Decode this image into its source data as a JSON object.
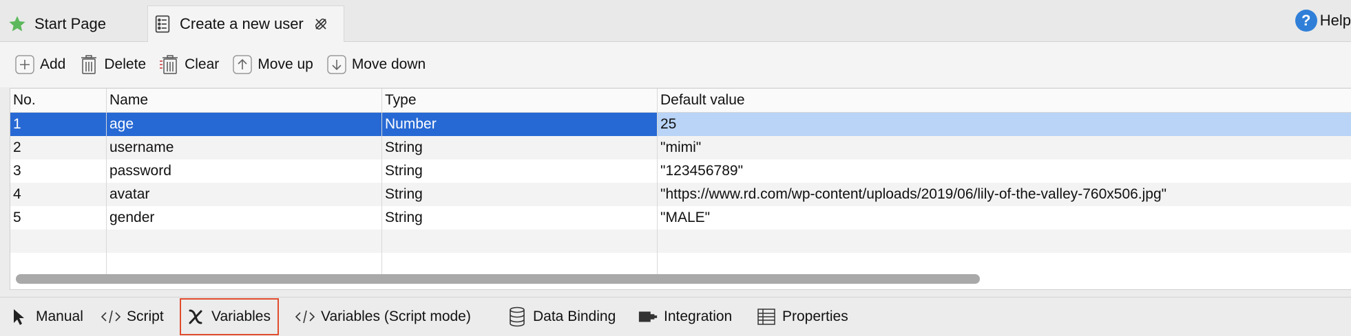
{
  "tabs": {
    "start_page": "Start Page",
    "active": "Create a new user",
    "help": "Help"
  },
  "toolbar": {
    "add": "Add",
    "delete": "Delete",
    "clear": "Clear",
    "move_up": "Move up",
    "move_down": "Move down"
  },
  "table": {
    "columns": [
      "No.",
      "Name",
      "Type",
      "Default value"
    ],
    "rows": [
      {
        "no": "1",
        "name": "age",
        "type": "Number",
        "default": "25"
      },
      {
        "no": "2",
        "name": "username",
        "type": "String",
        "default": "\"mimi\""
      },
      {
        "no": "3",
        "name": "password",
        "type": "String",
        "default": "\"123456789\""
      },
      {
        "no": "4",
        "name": "avatar",
        "type": "String",
        "default": "\"https://www.rd.com/wp-content/uploads/2019/06/lily-of-the-valley-760x506.jpg\""
      },
      {
        "no": "5",
        "name": "gender",
        "type": "String",
        "default": "\"MALE\""
      }
    ]
  },
  "bottom_tabs": {
    "manual": "Manual",
    "script": "Script",
    "variables": "Variables",
    "variables_script": "Variables (Script mode)",
    "data_binding": "Data Binding",
    "integration": "Integration",
    "properties": "Properties"
  },
  "icons": {
    "start_page": "star-icon",
    "active_tab": "test-case-icon",
    "close": "close-icon",
    "help": "help-icon",
    "add": "plus-icon",
    "delete": "trash-icon",
    "clear": "clear-trash-icon",
    "move_up": "arrow-up-icon",
    "move_down": "arrow-down-icon",
    "manual": "cursor-icon",
    "script": "code-icon",
    "variables": "variable-x-icon",
    "variables_script": "code-icon",
    "data_binding": "database-icon",
    "integration": "integration-icon",
    "properties": "table-icon"
  },
  "colors": {
    "selection": "#2769d4",
    "selection_cell": "#b9d4f6",
    "active_bottom_tab_border": "#e04b2b",
    "help_icon": "#2f7fd8",
    "star": "#5cb85c"
  }
}
